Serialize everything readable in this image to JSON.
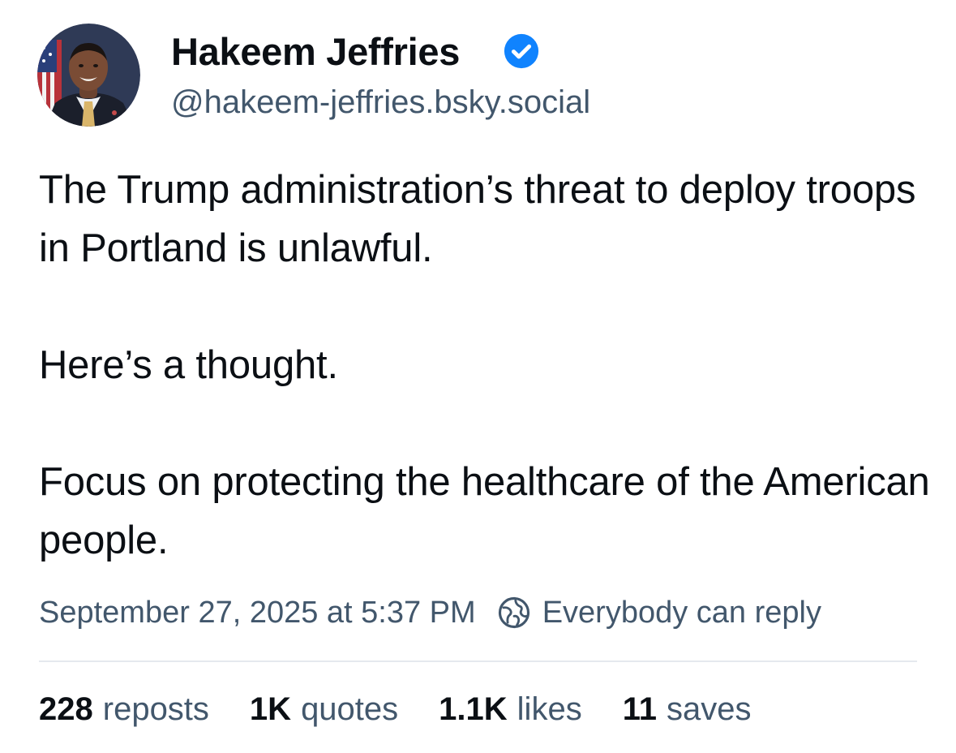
{
  "author": {
    "display_name": "Hakeem Jeffries",
    "handle": "@hakeem-jeffries.bsky.social",
    "verified": true,
    "verified_color": "#1083fe"
  },
  "post": {
    "paragraphs": [
      "The Trump administration’s threat to deploy troops in Portland is unlawful.",
      "Here’s a thought.",
      "Focus on protecting the healthcare of the American people."
    ]
  },
  "meta": {
    "timestamp": "September 27, 2025 at 5:37 PM",
    "reply_setting": "Everybody can reply",
    "reply_icon": "globe-icon"
  },
  "stats": {
    "reposts": {
      "count": "228",
      "label": "reposts"
    },
    "quotes": {
      "count": "1K",
      "label": "quotes"
    },
    "likes": {
      "count": "1.1K",
      "label": "likes"
    },
    "saves": {
      "count": "11",
      "label": "saves"
    }
  },
  "colors": {
    "text": "#0b0f14",
    "muted": "#42576c",
    "divider": "#e5e9ee",
    "accent": "#1083fe"
  }
}
